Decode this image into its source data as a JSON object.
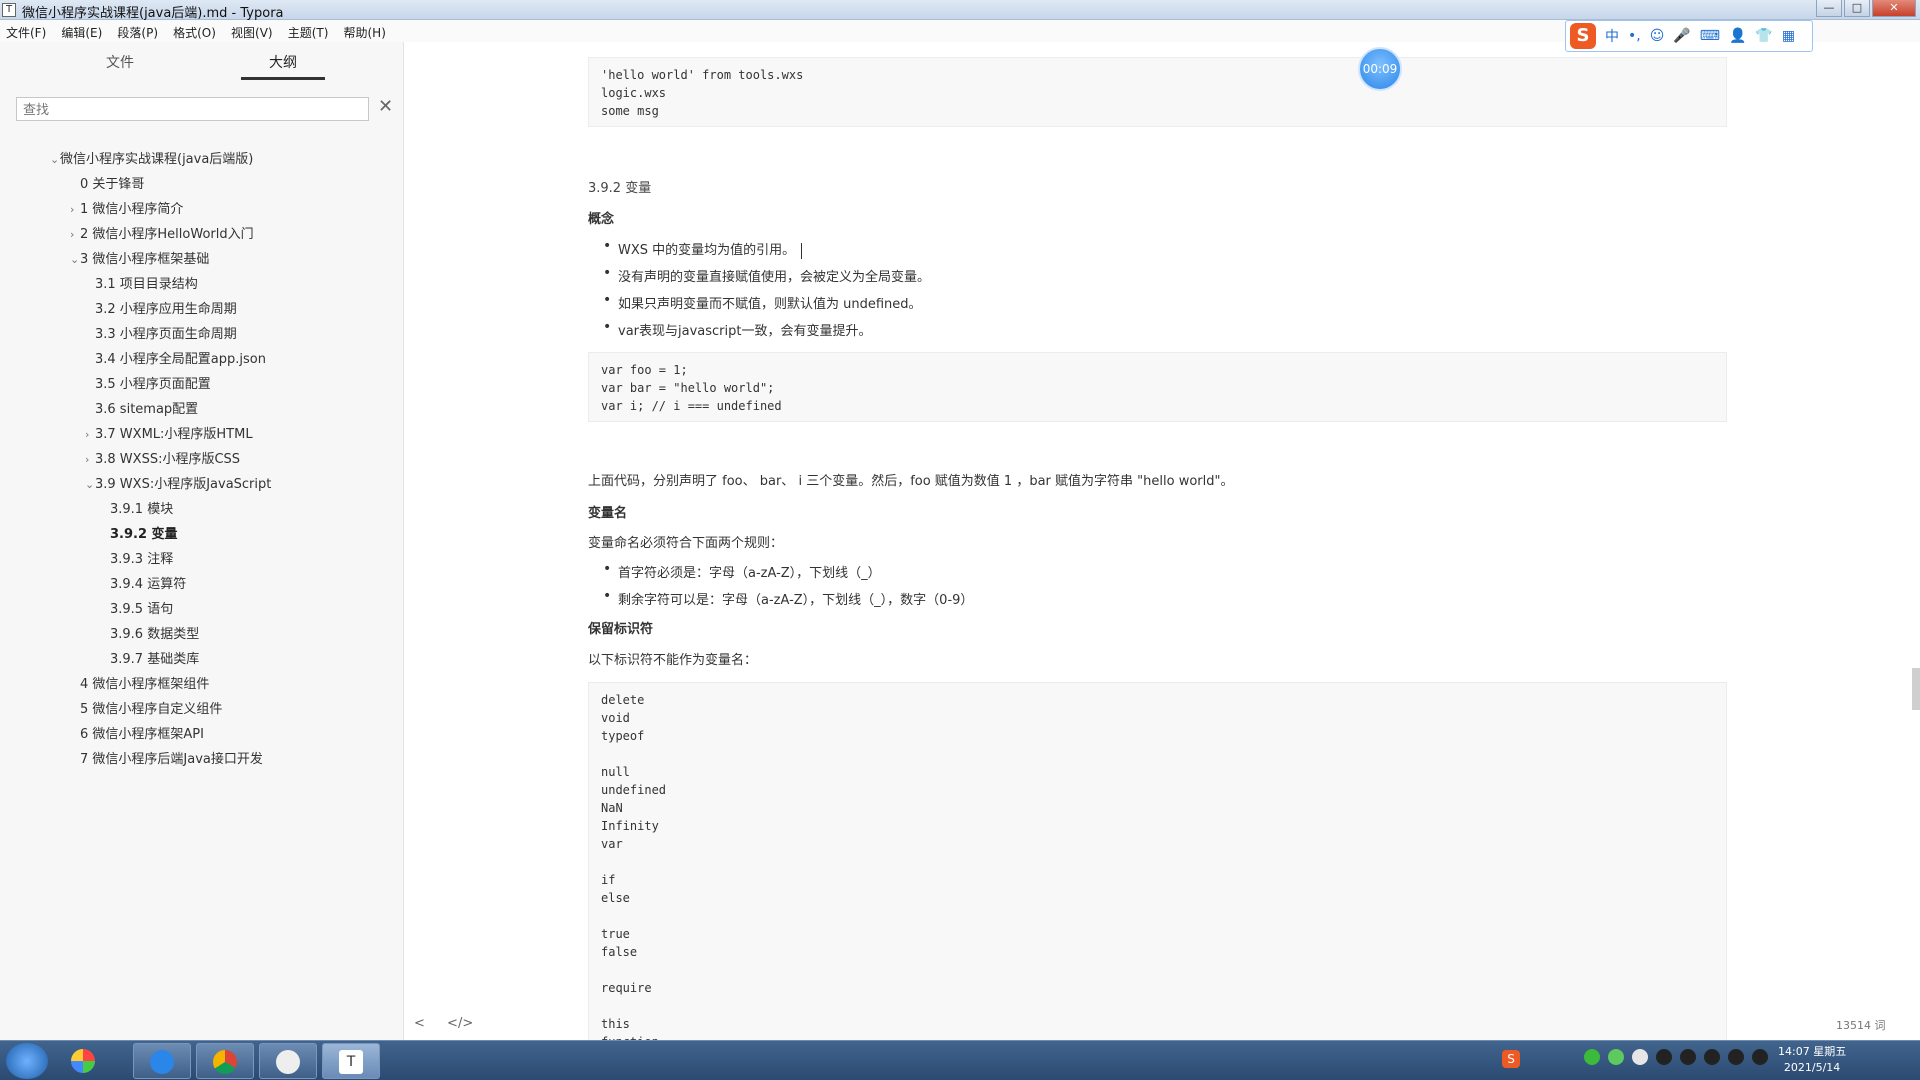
{
  "window": {
    "title": "微信小程序实战课程(java后端).md - Typora",
    "app_icon": "T",
    "buttons": [
      "—",
      "□",
      "✕"
    ]
  },
  "menu": [
    "文件(F)",
    "编辑(E)",
    "段落(P)",
    "格式(O)",
    "视图(V)",
    "主题(T)",
    "帮助(H)"
  ],
  "ime": {
    "lang": "中",
    "punct": "•,",
    "logo": "S"
  },
  "sidebar": {
    "tabs": {
      "files": "文件",
      "outline": "大纲"
    },
    "search_placeholder": "查找",
    "search_clear": "✕",
    "outline": [
      {
        "label": "微信小程序实战课程(java后端版)",
        "level": 0,
        "caret": "v"
      },
      {
        "label": "0 关于锋哥",
        "level": 1,
        "caret": ""
      },
      {
        "label": "1 微信小程序简介",
        "level": 1,
        "caret": ">"
      },
      {
        "label": "2 微信小程序HelloWorld入门",
        "level": 1,
        "caret": ">"
      },
      {
        "label": "3 微信小程序框架基础",
        "level": 1,
        "caret": "v"
      },
      {
        "label": "3.1 项目目录结构",
        "level": 2,
        "caret": ""
      },
      {
        "label": "3.2 小程序应用生命周期",
        "level": 2,
        "caret": ""
      },
      {
        "label": "3.3 小程序页面生命周期",
        "level": 2,
        "caret": ""
      },
      {
        "label": "3.4 小程序全局配置app.json",
        "level": 2,
        "caret": ""
      },
      {
        "label": "3.5 小程序页面配置",
        "level": 2,
        "caret": ""
      },
      {
        "label": "3.6 sitemap配置",
        "level": 2,
        "caret": ""
      },
      {
        "label": "3.7 WXML:小程序版HTML",
        "level": 2,
        "caret": ">"
      },
      {
        "label": "3.8 WXSS:小程序版CSS",
        "level": 2,
        "caret": ">"
      },
      {
        "label": "3.9 WXS:小程序版JavaScript",
        "level": 2,
        "caret": "v"
      },
      {
        "label": "3.9.1 模块",
        "level": 3,
        "caret": ""
      },
      {
        "label": "3.9.2 变量",
        "level": 3,
        "caret": "",
        "active": true
      },
      {
        "label": "3.9.3 注释",
        "level": 3,
        "caret": ""
      },
      {
        "label": "3.9.4 运算符",
        "level": 3,
        "caret": ""
      },
      {
        "label": "3.9.5 语句",
        "level": 3,
        "caret": ""
      },
      {
        "label": "3.9.6 数据类型",
        "level": 3,
        "caret": ""
      },
      {
        "label": "3.9.7 基础类库",
        "level": 3,
        "caret": ""
      },
      {
        "label": "4 微信小程序框架组件",
        "level": 1,
        "caret": ""
      },
      {
        "label": "5 微信小程序自定义组件",
        "level": 1,
        "caret": ""
      },
      {
        "label": "6 微信小程序框架API",
        "level": 1,
        "caret": ""
      },
      {
        "label": "7 微信小程序后端Java接口开发",
        "level": 1,
        "caret": ""
      }
    ]
  },
  "editor": {
    "code1": "'hello world' from tools.wxs\nlogic.wxs\nsome msg",
    "section_title": "3.9.2 变量",
    "h_concept": "概念",
    "concept_items": [
      "WXS 中的变量均为值的引用。",
      "没有声明的变量直接赋值使用，会被定义为全局变量。",
      "如果只声明变量而不赋值，则默认值为 undefined。",
      "var表现与javascript一致，会有变量提升。"
    ],
    "code2": "var foo = 1;\nvar bar = \"hello world\";\nvar i; // i === undefined",
    "para1": "上面代码，分别声明了 foo、 bar、 i 三个变量。然后，foo 赋值为数值 1 ，bar 赋值为字符串 \"hello world\"。",
    "h_varname": "变量名",
    "varname_intro": "变量命名必须符合下面两个规则：",
    "varname_items": [
      "首字符必须是：字母（a-zA-Z），下划线（_）",
      "剩余字符可以是：字母（a-zA-Z），下划线（_），数字（0-9）"
    ],
    "h_reserved": "保留标识符",
    "reserved_intro": "以下标识符不能作为变量名：",
    "code3": "delete\nvoid\ntypeof\n\nnull\nundefined\nNaN\nInfinity\nvar\n\nif\nelse\n\ntrue\nfalse\n\nrequire\n\nthis\nfunction"
  },
  "timer": "00:09",
  "status": {
    "word_count": "13514 词",
    "prev": "<",
    "source": "</>"
  },
  "taskbar": {
    "time": "14:07 星期五",
    "date": "2021/5/14"
  },
  "colors": {
    "accent": "#2a86e8",
    "taskbar": "#2b4a72"
  }
}
